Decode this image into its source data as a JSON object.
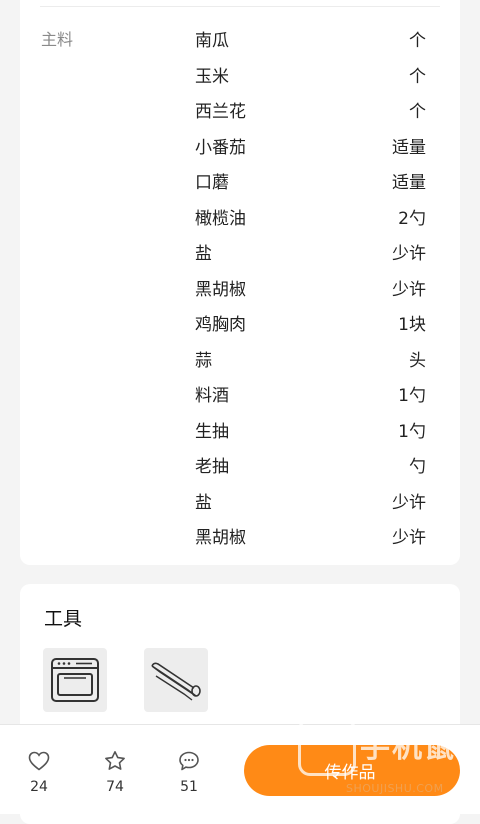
{
  "ingredients": {
    "section_label": "主料",
    "items": [
      {
        "name": "南瓜",
        "amount": "个"
      },
      {
        "name": "玉米",
        "amount": "个"
      },
      {
        "name": "西兰花",
        "amount": "个"
      },
      {
        "name": "小番茄",
        "amount": "适量"
      },
      {
        "name": "口蘑",
        "amount": "适量"
      },
      {
        "name": "橄榄油",
        "amount": "2勺"
      },
      {
        "name": "盐",
        "amount": "少许"
      },
      {
        "name": "黑胡椒",
        "amount": "少许"
      },
      {
        "name": "鸡胸肉",
        "amount": "1块"
      },
      {
        "name": "蒜",
        "amount": "头"
      },
      {
        "name": "料酒",
        "amount": "1勺"
      },
      {
        "name": "生抽",
        "amount": "1勺"
      },
      {
        "name": "老抽",
        "amount": "勺"
      },
      {
        "name": "盐",
        "amount": "少许"
      },
      {
        "name": "黑胡椒",
        "amount": "少许"
      }
    ]
  },
  "tools": {
    "title": "工具",
    "items": [
      {
        "icon": "oven-icon"
      },
      {
        "icon": "foil-roll-icon"
      }
    ]
  },
  "bottom_bar": {
    "likes": "24",
    "favorites": "74",
    "comments": "51",
    "upload_label": "传作品",
    "accent_color": "#ff8a16"
  },
  "watermark": {
    "text": "手机鼠",
    "sub": "SHOUJISHU.COM"
  }
}
